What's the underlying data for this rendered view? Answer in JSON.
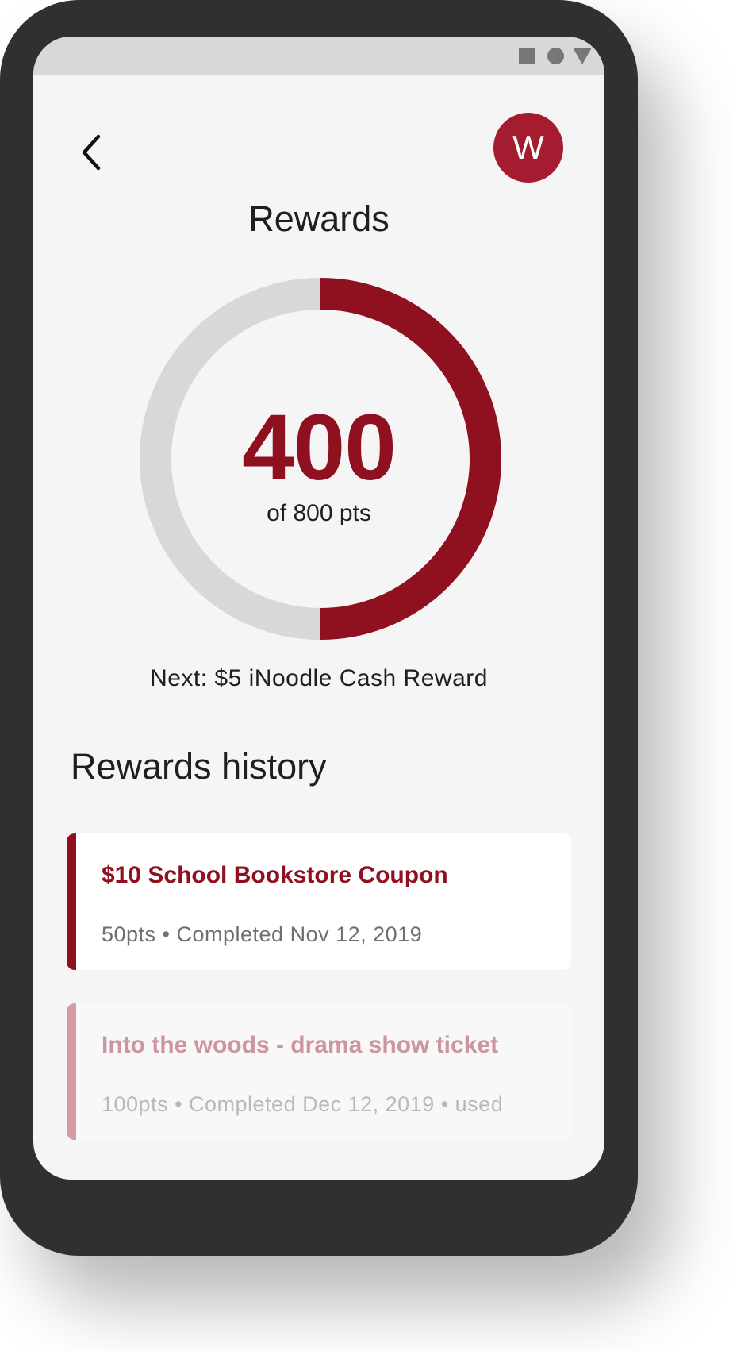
{
  "header": {
    "title": "Rewards",
    "avatar_initial": "W"
  },
  "progress": {
    "current_points": "400",
    "total_label": "of 800 pts",
    "fraction": 0.5,
    "fill_color": "#8f101f",
    "track_color": "#d8d8d8"
  },
  "next_reward": "Next: $5 iNoodle Cash Reward",
  "history": {
    "heading": "Rewards history",
    "items": [
      {
        "title": "$10 School Bookstore Coupon",
        "meta": "50pts • Completed Nov 12, 2019",
        "state": "active"
      },
      {
        "title": "Into the woods - drama show ticket",
        "meta": "100pts • Completed Dec 12, 2019 • used",
        "state": "used"
      }
    ]
  },
  "icons": {
    "back": "chevron-left-icon",
    "status": [
      "square-icon",
      "circle-icon",
      "triangle-icon"
    ]
  },
  "colors": {
    "brand": "#8f101f",
    "avatar": "#a51c30",
    "background": "#f5f5f5"
  }
}
